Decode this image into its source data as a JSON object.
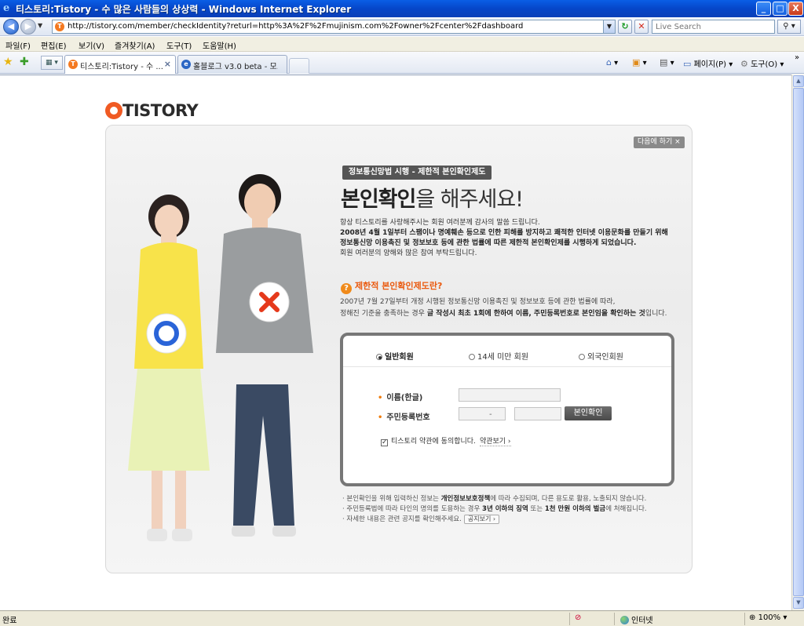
{
  "window": {
    "title": "티스토리:Tistory - 수 많은 사람들의 상상력 - Windows Internet Explorer",
    "minimize": "_",
    "maximize": "□",
    "close": "X"
  },
  "address": {
    "url": "http://tistory.com/member/checkIdentity?returl=http%3A%2F%2Fmujinism.com%2Fowner%2Fcenter%2Fdashboard",
    "search_placeholder": "Live Search"
  },
  "menu": {
    "items": [
      "파일(F)",
      "편집(E)",
      "보기(V)",
      "즐겨찾기(A)",
      "도구(T)",
      "도움말(H)"
    ]
  },
  "tabs": [
    {
      "label": "티스토리:Tistory - 수 ...",
      "close": "×"
    },
    {
      "label": "홀블로그 v3.0 beta - 모..."
    }
  ],
  "commandbar": {
    "page": "페이지(P)",
    "tools": "도구(O)",
    "more": "»"
  },
  "page": {
    "logo_text": "TISTORY",
    "skip_label": "다음에 하기 ×",
    "law_tag": "정보통신망법 시행 - 제한적 본인확인제도",
    "headline_bold": "본인확인",
    "headline_rest": "을 해주세요!",
    "intro": [
      "항상 티스토리를 사랑해주시는 회원 여러분께 감사의 말씀 드립니다.",
      "2008년 4월 1일부터 스팸이나 명예훼손 등으로 인한 피해를 방지하고 쾌적한 인터넷 이용문화를 만들기 위해",
      "정보통신망 이용촉진 및 정보보호 등에 관한 법률에 따른 제한적 본인확인제를 시행하게 되었습니다.",
      "회원 여러분의 양해와 많은 참여 부탁드립니다."
    ],
    "question_title": "제한적 본인확인제도란?",
    "question_line1": "2007년 7월 27일부터 개정 시행된 정보통신망 이용촉진 및 정보보호 등에 관한 법률에 따라,",
    "question_line2_pre": "정해진 기준을 충족하는 경우 ",
    "question_line2_bold": "글 작성시 최초 1회에 한하여 이름, 주민등록번호로 본인임을 확인하는 것",
    "question_line2_post": "입니다.",
    "form": {
      "radio_general": "일반회원",
      "radio_under14": "14세 미만 회원",
      "radio_foreign": "외국인회원",
      "name_label": "이름(한글)",
      "rrn_label": "주민등록번호",
      "dash": "-",
      "verify_button": "본인확인",
      "agree_text": "티스토리 약관에 동의합니다.",
      "terms_link": "약관보기 ›"
    },
    "notes": {
      "line1_pre": "· 본인확인을 위해 입력하신 정보는 ",
      "line1_bold": "개인정보보호정책",
      "line1_post": "에 따라 수집되며, 다른 용도로 활용, 노출되지 않습니다.",
      "line2_pre": "· 주민등록법에 따라 타인의 명의를 도용하는 경우 ",
      "line2_bold1": "3년 이하의 징역",
      "line2_mid": " 또는 ",
      "line2_bold2": "1천 만원 이하의 벌금",
      "line2_post": "에 처해집니다.",
      "line3": "· 자세한 내용은 관련 공지를 확인해주세요.",
      "notice_button": "공지보기 ›"
    }
  },
  "status": {
    "done": "완료",
    "zone": "인터넷",
    "zoom": "100%"
  }
}
